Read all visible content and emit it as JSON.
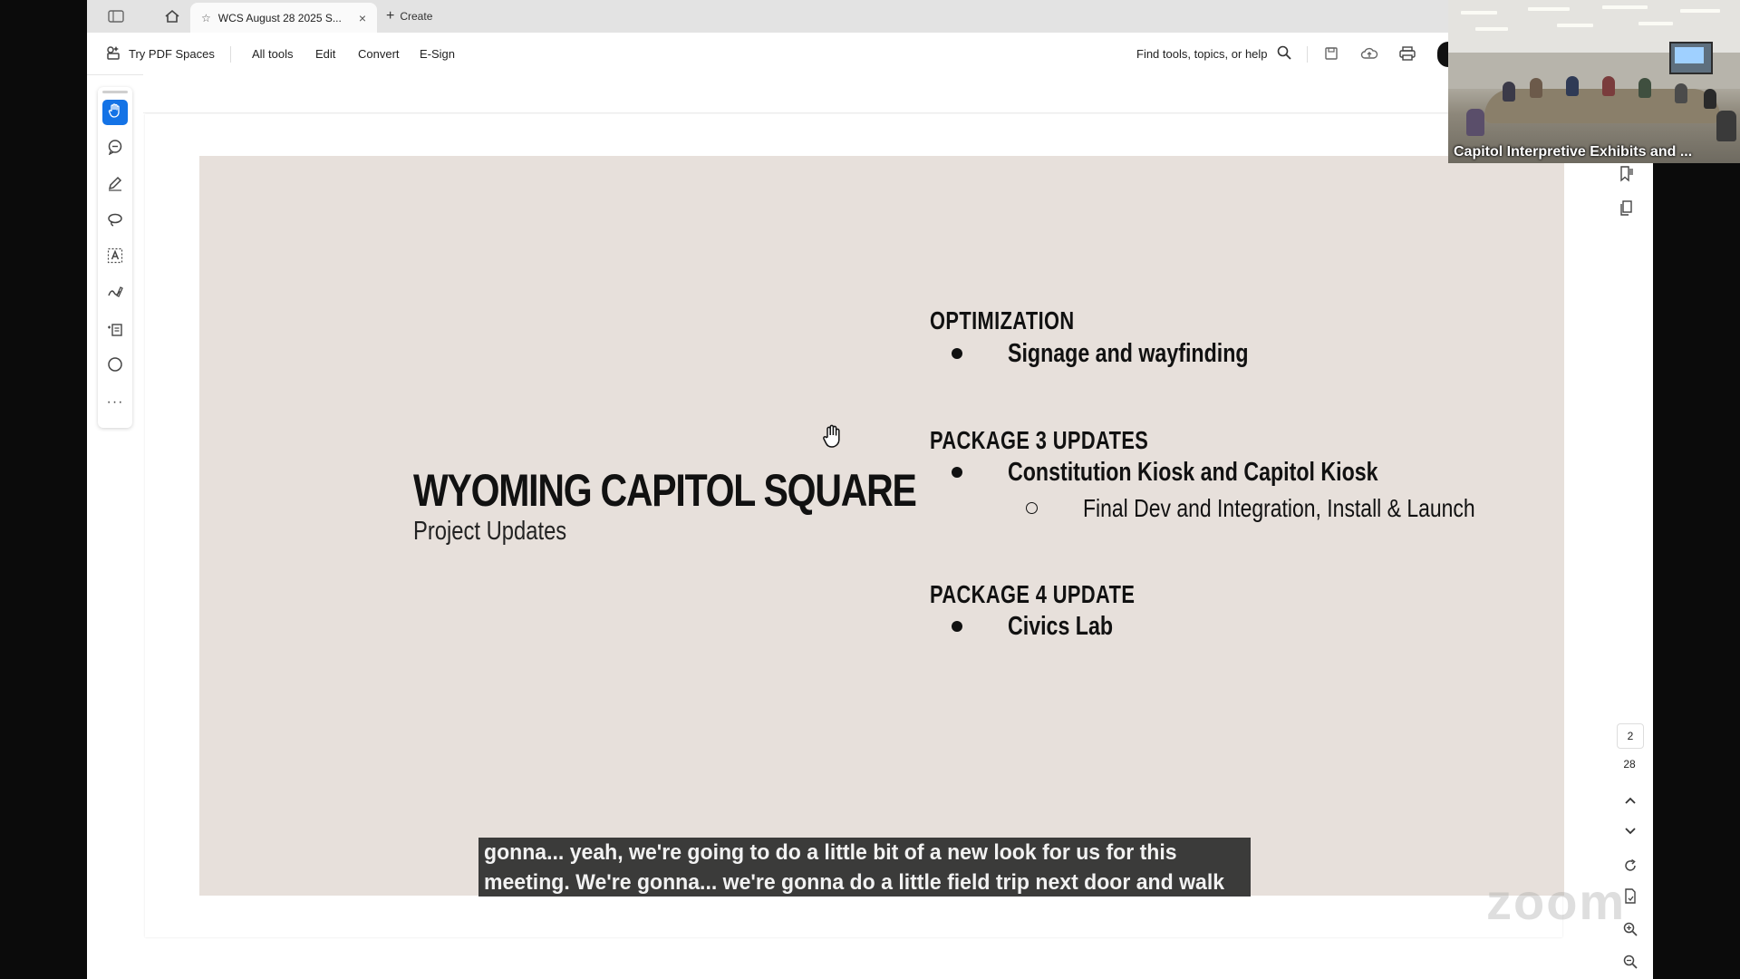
{
  "browser": {
    "tab_title": "WCS August 28 2025 S...",
    "tab_close": "×",
    "create_label": "Create"
  },
  "toolbar": {
    "try_pdf_spaces": "Try PDF Spaces",
    "menu": [
      "All tools",
      "Edit",
      "Convert",
      "E-Sign"
    ],
    "search_label": "Find tools, topics, or help"
  },
  "slide": {
    "title": "WYOMING CAPITOL SQUARE",
    "subtitle": "Project Updates",
    "sections": [
      {
        "heading": "OPTIMIZATION",
        "bullets": [
          "Signage and wayfinding"
        ]
      },
      {
        "heading": "PACKAGE 3 UPDATES",
        "bullets": [
          "Constitution Kiosk and Capitol Kiosk"
        ],
        "sub_bullets": [
          "Final Dev and Integration, Install & Launch"
        ]
      },
      {
        "heading": "PACKAGE 4 UPDATE",
        "bullets": [
          "Civics Lab"
        ]
      }
    ]
  },
  "caption": {
    "line1": "gonna... yeah, we're going to do a little bit of a new look for us for this",
    "line2": "meeting. We're gonna... we're gonna do a little field trip next door and walk"
  },
  "navigation": {
    "current_page": "2",
    "total_pages": "28"
  },
  "video": {
    "participant_label": "Capitol Interpretive Exhibits and ..."
  },
  "watermark": "zoom",
  "icons": {
    "rail": [
      "hand-icon",
      "comment-icon",
      "pen-icon",
      "lasso-icon",
      "text-select-icon",
      "sign-icon",
      "insert-icon",
      "shape-icon",
      "more-icon"
    ]
  },
  "colors": {
    "accent": "#1473e6",
    "slide_bg": "#e7e0db",
    "caption_bg": "#232323"
  }
}
